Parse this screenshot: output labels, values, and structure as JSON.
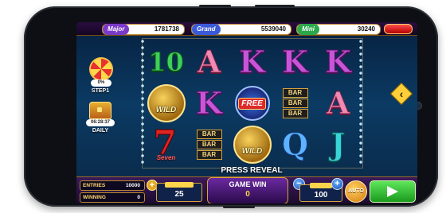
{
  "jackpots": [
    {
      "label": "Major",
      "value": "1781738",
      "color": "#7a3ac8"
    },
    {
      "label": "Grand",
      "value": "5539040",
      "color": "#3a5ad8"
    },
    {
      "label": "Mini",
      "value": "30240",
      "color": "#2aa84a"
    }
  ],
  "sidebar": {
    "wheel_percent": "0%",
    "wheel_label": "STEP1",
    "chest_timer": "06:28:37",
    "chest_label": "DAILY"
  },
  "reels": [
    [
      {
        "type": "letter",
        "text": "10",
        "color": "green"
      },
      {
        "type": "wild",
        "text": "WILD"
      },
      {
        "type": "seven",
        "text": "7",
        "sub": "Seven"
      }
    ],
    [
      {
        "type": "letter",
        "text": "A",
        "color": "pink"
      },
      {
        "type": "letter",
        "text": "K",
        "color": "purple"
      },
      {
        "type": "bar",
        "text": "BAR"
      }
    ],
    [
      {
        "type": "letter",
        "text": "K",
        "color": "purple"
      },
      {
        "type": "free",
        "text": "FREE"
      },
      {
        "type": "wild",
        "text": "WILD"
      }
    ],
    [
      {
        "type": "letter",
        "text": "K",
        "color": "purple"
      },
      {
        "type": "bar",
        "text": "BAR"
      },
      {
        "type": "letter",
        "text": "Q",
        "color": "blue"
      }
    ],
    [
      {
        "type": "letter",
        "text": "K",
        "color": "purple"
      },
      {
        "type": "letter",
        "text": "A",
        "color": "pink"
      },
      {
        "type": "letter",
        "text": "J",
        "color": "teal"
      }
    ]
  ],
  "press_reveal": "PRESS REVEAL",
  "bottom": {
    "entries_label": "ENTRIES",
    "entries_value": "10000",
    "winning_label": "WINNING",
    "winning_value": "0",
    "lines_value": "25",
    "game_win_label": "GAME WIN",
    "game_win_value": "0",
    "bet_value": "100",
    "auto_label": "AUTO",
    "minus": "−",
    "plus": "+"
  }
}
